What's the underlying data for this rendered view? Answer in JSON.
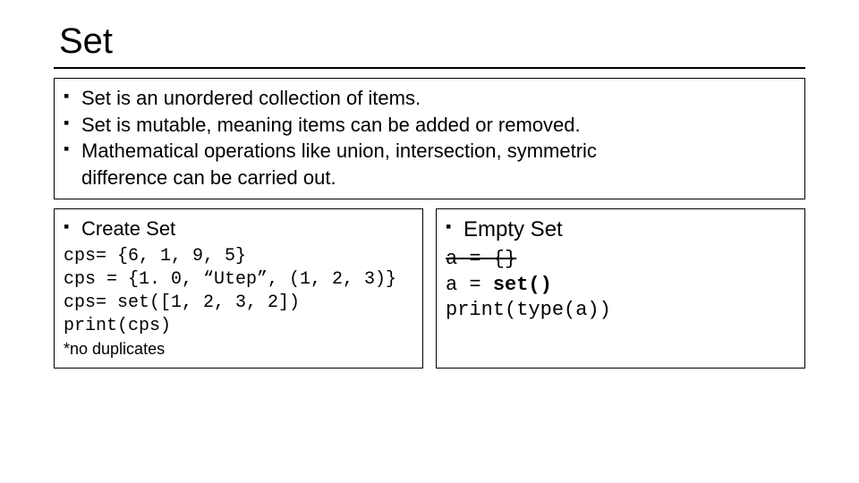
{
  "title": "Set",
  "topBox": {
    "b1": "Set is an unordered collection of items.",
    "b2": "Set is mutable, meaning items can be added or removed.",
    "b3a": "Mathematical operations like union, intersection, symmetric",
    "b3b": "difference can be carried out."
  },
  "leftBox": {
    "heading": "Create Set",
    "l1": "cps= {6, 1, 9, 5}",
    "l2": "cps = {1. 0, “Utep”, (1, 2, 3)}",
    "l3": "cps= set([1, 2, 3, 2])",
    "l4": "print(cps)",
    "note": "*no duplicates"
  },
  "rightBox": {
    "heading": "Empty Set",
    "l1": "a = {}",
    "l2a": "a = ",
    "l2b": "set()",
    "l3": "print(type(a))"
  }
}
